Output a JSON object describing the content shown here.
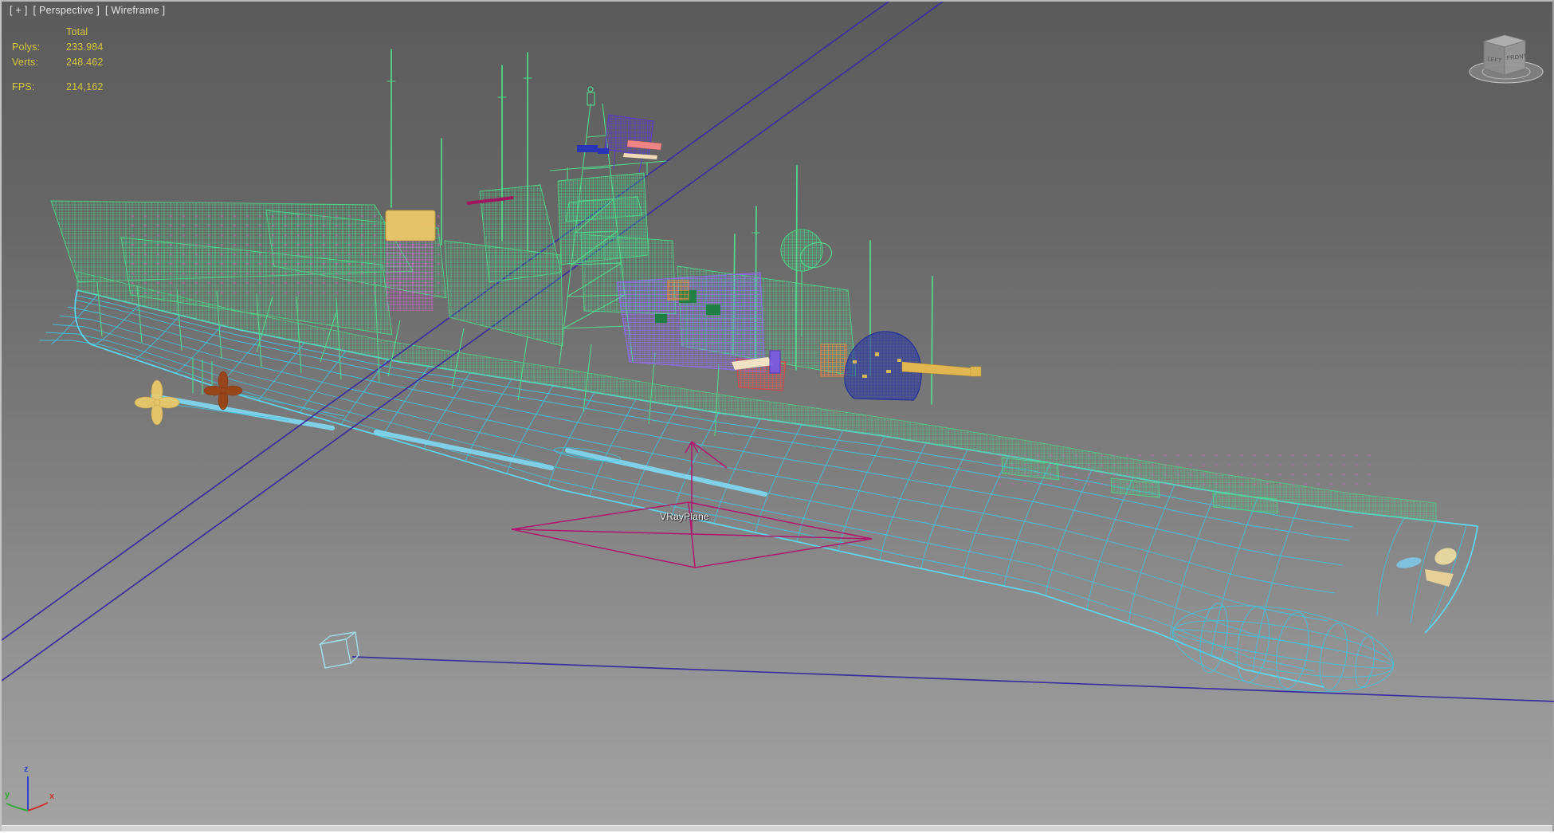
{
  "viewport": {
    "nav_plus": "[ + ]",
    "nav_view": "[ Perspective ]",
    "nav_shading": "[ Wireframe ]"
  },
  "stats": {
    "total_header": "Total",
    "polys_label": "Polys:",
    "polys_value": "233.984",
    "verts_label": "Verts:",
    "verts_value": "248.462",
    "fps_label": "FPS:",
    "fps_value": "214,162"
  },
  "scene": {
    "vray_plane_label": "VRayPlane"
  },
  "viewcube": {
    "left_face": "LEFT",
    "front_face": "FRONT"
  },
  "axis_tripod": {
    "x": "x",
    "y": "y",
    "z": "z"
  },
  "colors": {
    "background_top": "#5b5b5b",
    "background_bottom": "#a5a5a5",
    "stats_yellow": "#d8c83c",
    "viewport_label_gray": "#e6e6e6",
    "hull_cyan": "#3fc3e0",
    "superstructure_green": "#52da8c",
    "violet_structure": "#8f6df0",
    "purple_radar": "#5a3acc",
    "navy_turret": "#1e2a96",
    "gun_barrel_yellow": "#e2b752",
    "propeller_yellow": "#e9c96b",
    "propeller_brown": "#9a4214",
    "lifeboat_red": "#d84545",
    "orange_gear": "#e08848",
    "magenta_lattice": "#d565d5",
    "vray_gizmo_magenta": "#b1156e",
    "construction_line_indigo": "#3b2e9e",
    "axis_x_red": "#cc3333",
    "axis_y_green": "#33aa33",
    "axis_z_blue": "#3344cc"
  }
}
